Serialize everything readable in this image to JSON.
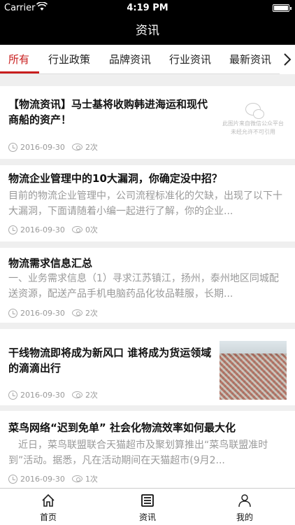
{
  "status_bar": {
    "carrier": "Carrier",
    "time": "4:19 PM"
  },
  "nav": {
    "title": "资讯"
  },
  "tabs": [
    {
      "label": "所有"
    },
    {
      "label": "行业政策"
    },
    {
      "label": "品牌资讯"
    },
    {
      "label": "行业资讯"
    },
    {
      "label": "最新资讯"
    }
  ],
  "articles": [
    {
      "title": "【物流资讯】马士基将收购韩进海运和现代商船的资产！",
      "date": "2016-09-30",
      "views": "2次",
      "placeholder_text": "此图片来自微信公众平台 未经允许不可引用"
    },
    {
      "title": "物流企业管理中的10大漏洞，你确定没中招？",
      "summary": "目前的物流企业管理中，公司流程标准化的欠缺，出现了以下十大漏洞，下面请随着小编一起进行了解，你的企业...",
      "date": "2016-09-30",
      "views": "0次"
    },
    {
      "title": "物流需求信息汇总",
      "summary": "一、业务需求信息（1）寻求江苏镇江，扬州，泰州地区同城配送资源，配送产品手机电脑药品化妆品鞋服，长期...",
      "date": "2016-09-30",
      "views": "2次"
    },
    {
      "title": "干线物流即将成为新风口 谁将成为货运领域的滴滴出行",
      "date": "2016-09-30",
      "views": "2次"
    },
    {
      "title": "菜鸟网络“迟到免单” 社会化物流效率如何最大化",
      "summary": "　近日，菜鸟联盟联合天猫超市及聚划算推出“菜鸟联盟准时到”活动。据悉，凡在活动期间在天猫超市(9月2...",
      "date": "2016-09-30",
      "views": "1次"
    }
  ],
  "bottom_tabs": [
    {
      "label": "首页",
      "icon": "home-icon"
    },
    {
      "label": "资讯",
      "icon": "news-icon"
    },
    {
      "label": "我的",
      "icon": "user-icon"
    }
  ],
  "colors": {
    "accent": "#c81e1e",
    "header_bg": "#000000"
  }
}
